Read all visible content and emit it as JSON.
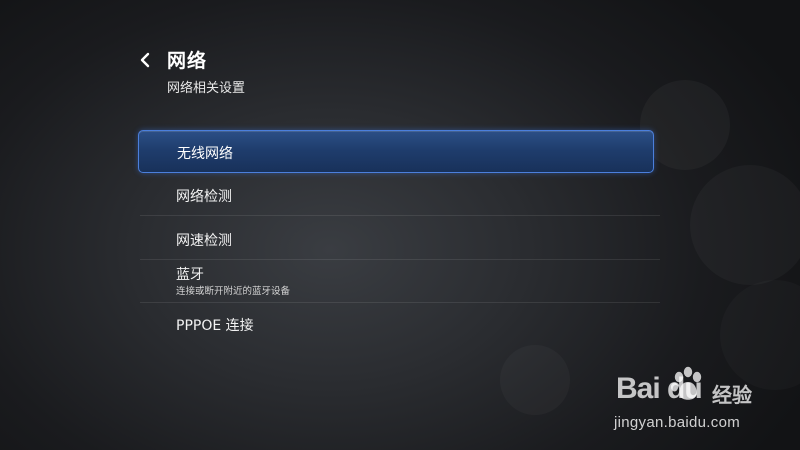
{
  "header": {
    "back_icon": "chevron-left-icon",
    "title": "网络",
    "subtitle": "网络相关设置"
  },
  "menu": {
    "items": [
      {
        "label": "无线网络",
        "sublabel": "",
        "selected": true
      },
      {
        "label": "网络检测",
        "sublabel": "",
        "selected": false
      },
      {
        "label": "网速检测",
        "sublabel": "",
        "selected": false
      },
      {
        "label": "蓝牙",
        "sublabel": "连接或断开附近的蓝牙设备",
        "selected": false
      },
      {
        "label": "PPPOE 连接",
        "sublabel": "",
        "selected": false
      }
    ]
  },
  "watermark": {
    "brand": "Bai  du",
    "brand_suffix": "经验",
    "url": "jingyan.baidu.com"
  },
  "colors": {
    "selection_border": "#4b7fdc",
    "selection_fill": "#1f3d6d",
    "background": "#1a1b1e"
  }
}
